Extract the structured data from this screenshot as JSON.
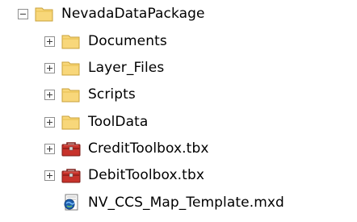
{
  "tree": {
    "root": {
      "label": "NevadaDataPackage",
      "icon": "folder-open-icon",
      "toggle": "collapse"
    },
    "children": [
      {
        "label": "Documents",
        "icon": "folder-icon",
        "toggle": "expand"
      },
      {
        "label": "Layer_Files",
        "icon": "folder-icon",
        "toggle": "expand"
      },
      {
        "label": "Scripts",
        "icon": "folder-icon",
        "toggle": "expand"
      },
      {
        "label": "ToolData",
        "icon": "folder-icon",
        "toggle": "expand"
      },
      {
        "label": "CreditToolbox.tbx",
        "icon": "toolbox-icon",
        "toggle": "expand"
      },
      {
        "label": "DebitToolbox.tbx",
        "icon": "toolbox-icon",
        "toggle": "expand"
      },
      {
        "label": "NV_CCS_Map_Template.mxd",
        "icon": "map-document-icon",
        "toggle": "none"
      }
    ]
  },
  "colors": {
    "folder_fill": "#f8d77a",
    "folder_edge": "#c9a13b",
    "toolbox_red": "#c7322b",
    "map_doc_blue": "#1f5fae"
  }
}
